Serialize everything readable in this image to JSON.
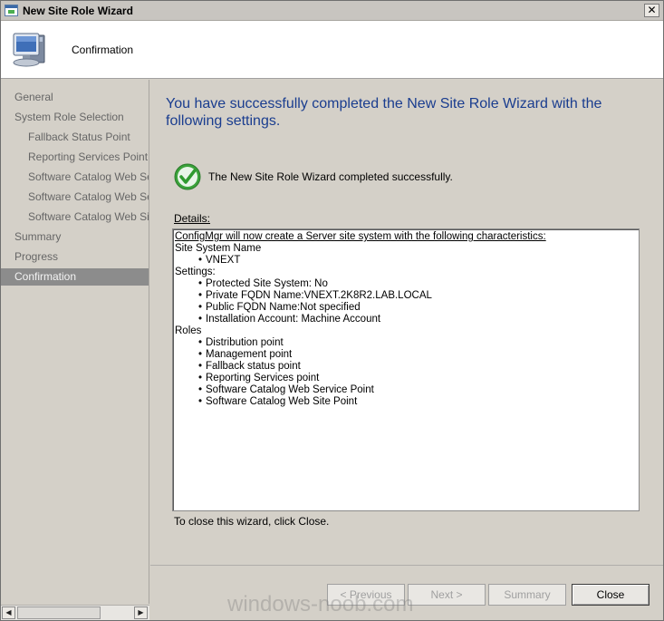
{
  "window": {
    "title": "New Site Role Wizard",
    "close_glyph": "✕"
  },
  "header": {
    "title": "Confirmation",
    "icon": "computer-icon"
  },
  "nav": {
    "items": [
      {
        "label": "General",
        "level": 1,
        "active": false
      },
      {
        "label": "System Role Selection",
        "level": 1,
        "active": false
      },
      {
        "label": "Fallback Status Point",
        "level": 2,
        "active": false
      },
      {
        "label": "Reporting Services Point",
        "level": 2,
        "active": false
      },
      {
        "label": "Software Catalog Web Ser",
        "level": 2,
        "active": false
      },
      {
        "label": "Software Catalog Web Ser",
        "level": 2,
        "active": false
      },
      {
        "label": "Software Catalog Web Site",
        "level": 2,
        "active": false
      },
      {
        "label": "Summary",
        "level": 1,
        "active": false
      },
      {
        "label": "Progress",
        "level": 1,
        "active": false
      },
      {
        "label": "Confirmation",
        "level": 1,
        "active": true
      }
    ],
    "scroll_left": "◀",
    "scroll_right": "▶"
  },
  "main": {
    "headline": "You have successfully completed the New Site Role Wizard with the following settings.",
    "status_icon": "green-check-icon",
    "status_text": "The New Site Role Wizard completed successfully.",
    "details_label": "Details:",
    "details": {
      "intro": "ConfigMgr will now create a Server site system with the following characteristics:",
      "site_system_heading": "Site System Name",
      "site_system_items": [
        "VNEXT"
      ],
      "settings_heading": "Settings:",
      "settings_items": [
        "Protected Site System: No",
        "Private FQDN Name:VNEXT.2K8R2.LAB.LOCAL",
        "Public FQDN Name:Not specified",
        "Installation Account: Machine Account"
      ],
      "roles_heading": "Roles",
      "roles_items": [
        "Distribution point",
        "Management point",
        "Fallback status point",
        "Reporting Services point",
        "Software Catalog Web Service Point",
        "Software Catalog Web Site Point"
      ]
    },
    "close_hint": "To close this wizard, click Close."
  },
  "buttons": {
    "previous": "< Previous",
    "next": "Next >",
    "summary": "Summary",
    "close": "Close"
  },
  "watermark": "windows-noob.com",
  "colors": {
    "headline": "#1a3d8f",
    "nav_active_bg": "#8c8c8c",
    "check_green": "#3aa23a"
  }
}
